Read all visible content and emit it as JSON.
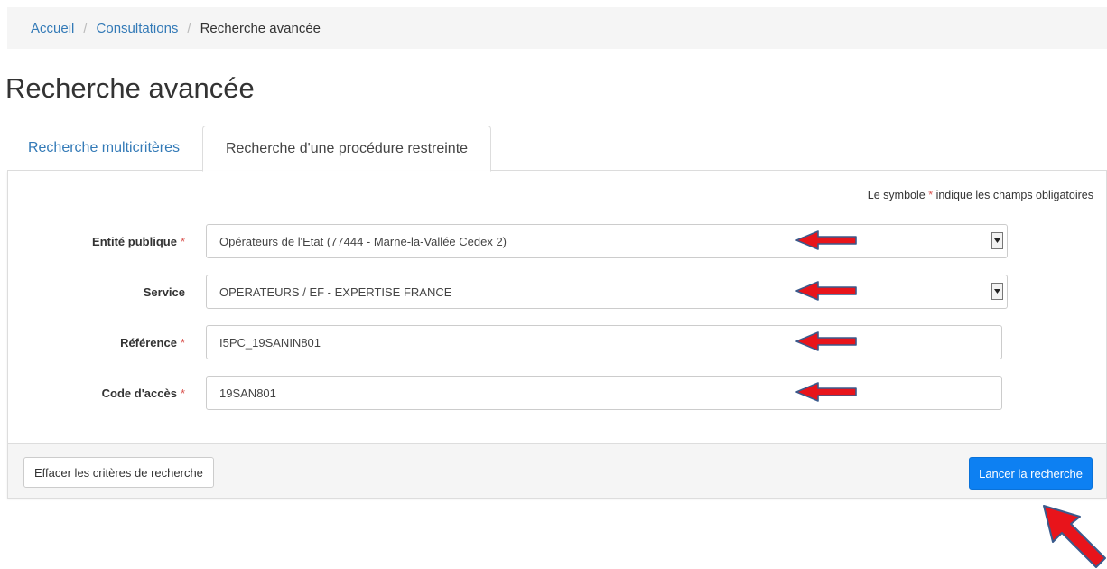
{
  "breadcrumb": {
    "items": [
      "Accueil",
      "Consultations",
      "Recherche avancée"
    ],
    "separator": "/"
  },
  "page": {
    "title": "Recherche avancée"
  },
  "tabs": [
    {
      "label": "Recherche multicritères",
      "active": false
    },
    {
      "label": "Recherche d'une procédure restreinte",
      "active": true
    }
  ],
  "form": {
    "required_note_before": "Le symbole",
    "required_star": "*",
    "required_note_after": "indique les champs obligatoires",
    "fields": [
      {
        "label": "Entité publique",
        "required": true,
        "type": "select",
        "value": "Opérateurs de l'Etat (77444 - Marne-la-Vallée Cedex 2)"
      },
      {
        "label": "Service",
        "required": false,
        "type": "select",
        "value": "OPERATEURS / EF - EXPERTISE FRANCE"
      },
      {
        "label": "Référence",
        "required": true,
        "type": "text",
        "value": "I5PC_19SANIN801"
      },
      {
        "label": "Code d'accès",
        "required": true,
        "type": "text",
        "value": "19SAN801"
      }
    ]
  },
  "footer": {
    "clear_label": "Effacer les critères de recherche",
    "search_label": "Lancer la recherche"
  },
  "colors": {
    "link": "#337ab7",
    "primary_button": "#0d80f2",
    "required_star": "#d9534f",
    "annotation_arrow_fill": "#e8141b",
    "annotation_arrow_stroke": "#3a5a8c"
  },
  "icons": {
    "select_caret": "caret-down-icon",
    "annotation": "red-arrow-icon"
  }
}
